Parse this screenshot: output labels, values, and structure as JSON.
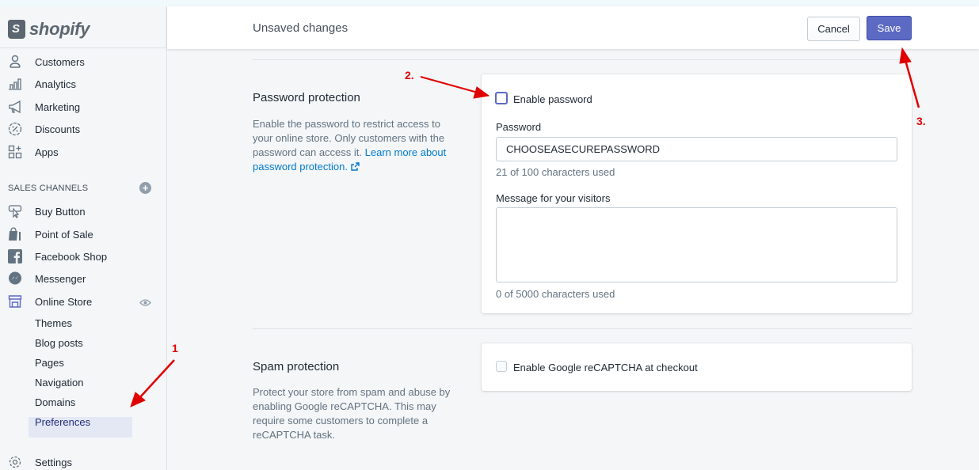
{
  "brand": {
    "name": "shopify"
  },
  "sidebar": {
    "main_items": [
      {
        "label": "Customers",
        "icon": "person-icon"
      },
      {
        "label": "Analytics",
        "icon": "bar-chart-icon"
      },
      {
        "label": "Marketing",
        "icon": "megaphone-icon"
      },
      {
        "label": "Discounts",
        "icon": "discount-icon"
      },
      {
        "label": "Apps",
        "icon": "apps-icon"
      }
    ],
    "sales_channels_title": "SALES CHANNELS",
    "channels": [
      {
        "label": "Buy Button",
        "icon": "buy-button-icon"
      },
      {
        "label": "Point of Sale",
        "icon": "shopify-bag-icon"
      },
      {
        "label": "Facebook Shop",
        "icon": "facebook-icon"
      },
      {
        "label": "Messenger",
        "icon": "messenger-icon"
      },
      {
        "label": "Online Store",
        "icon": "store-icon"
      }
    ],
    "online_store_sub": [
      "Themes",
      "Blog posts",
      "Pages",
      "Navigation",
      "Domains",
      "Preferences"
    ],
    "active_sub": "Preferences",
    "settings_label": "Settings"
  },
  "topbar": {
    "title": "Unsaved changes",
    "cancel_label": "Cancel",
    "save_label": "Save"
  },
  "password_section": {
    "heading": "Password protection",
    "description": "Enable the password to restrict access to your online store. Only customers with the password can access it. ",
    "link_text": "Learn more about password protection.",
    "checkbox_label": "Enable password",
    "password_label": "Password",
    "password_value": "CHOOSEASECUREPASSWORD",
    "password_help": "21 of 100 characters used",
    "message_label": "Message for your visitors",
    "message_value": "",
    "message_help": "0 of 5000 characters used"
  },
  "spam_section": {
    "heading": "Spam protection",
    "description": "Protect your store from spam and abuse by enabling Google reCAPTCHA. This may require some customers to complete a reCAPTCHA task.",
    "checkbox_label": "Enable Google reCAPTCHA at checkout"
  },
  "annotations": {
    "step1": "1",
    "step2": "2.",
    "step3": "3."
  },
  "colors": {
    "accent": "#5c6ac4",
    "annotation": "#e00000",
    "link": "#007ace"
  }
}
